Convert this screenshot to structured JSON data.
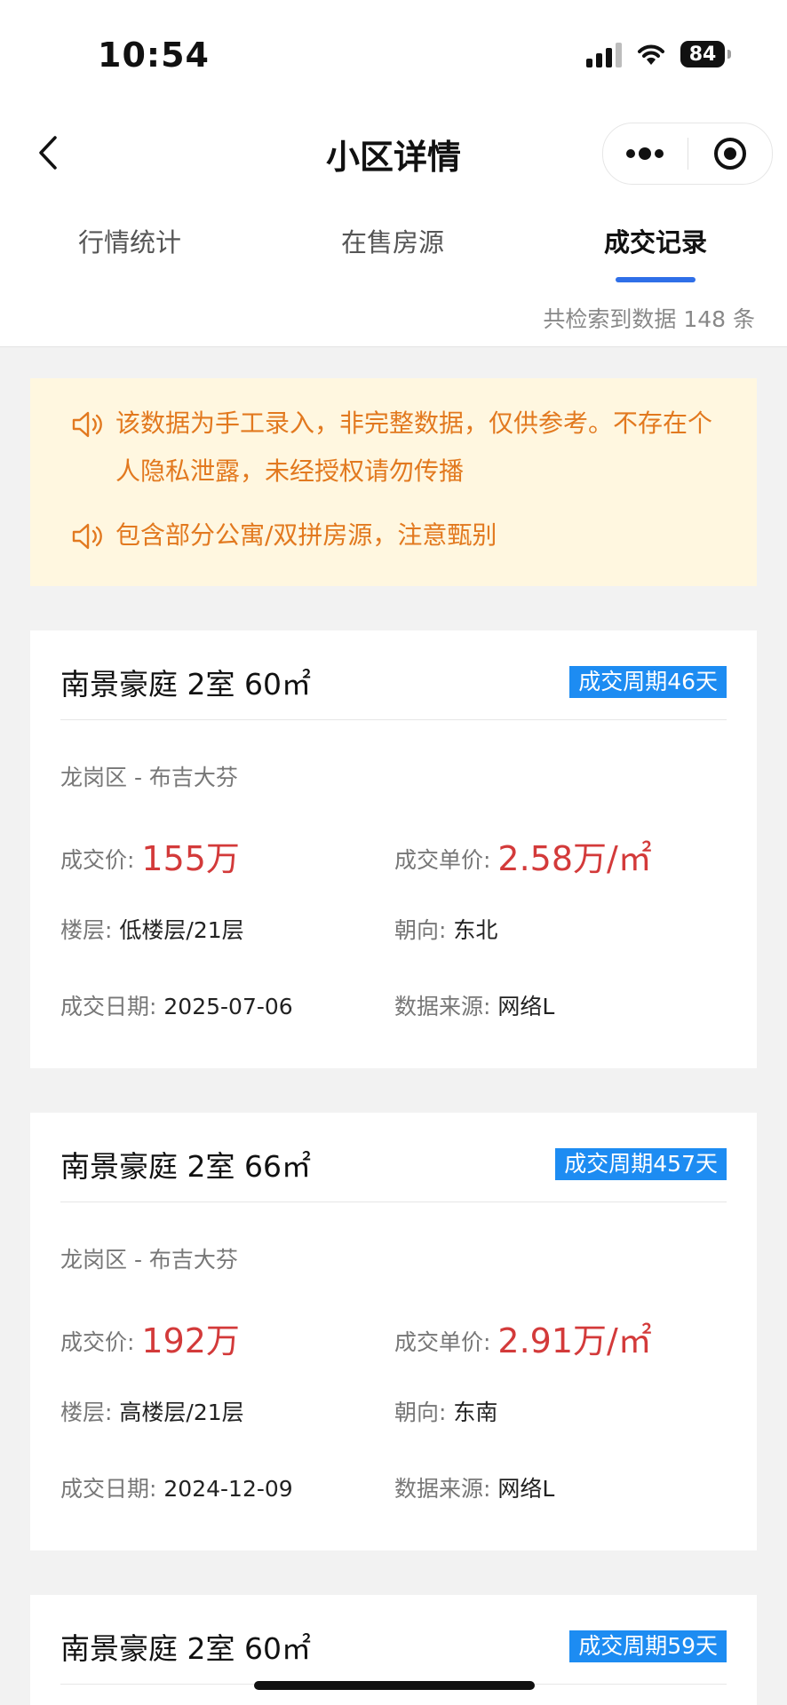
{
  "status_bar": {
    "time": "10:54",
    "battery": "84"
  },
  "header": {
    "title": "小区详情"
  },
  "tabs": [
    {
      "label": "行情统计"
    },
    {
      "label": "在售房源"
    },
    {
      "label": "成交记录"
    }
  ],
  "result_count": "共检索到数据 148 条",
  "notices": [
    "该数据为手工录入，非完整数据，仅供参考。不存在个人隐私泄露，未经授权请勿传播",
    "包含部分公寓/双拼房源，注意甄别"
  ],
  "labels": {
    "deal_price": "成交价:",
    "unit_price": "成交单价:",
    "floor": "楼层:",
    "orientation": "朝向:",
    "deal_date": "成交日期:",
    "source": "数据来源:"
  },
  "records": [
    {
      "title": "南景豪庭 2室 60㎡",
      "cycle": "成交周期46天",
      "district": "龙岗区 - 布吉大芬",
      "deal_price": "155万",
      "unit_price": "2.58万/㎡",
      "floor": "低楼层/21层",
      "orientation": "东北",
      "deal_date": "2025-07-06",
      "source": "网络L"
    },
    {
      "title": "南景豪庭 2室 66㎡",
      "cycle": "成交周期457天",
      "district": "龙岗区 - 布吉大芬",
      "deal_price": "192万",
      "unit_price": "2.91万/㎡",
      "floor": "高楼层/21层",
      "orientation": "东南",
      "deal_date": "2024-12-09",
      "source": "网络L"
    },
    {
      "title": "南景豪庭 2室 60㎡",
      "cycle": "成交周期59天"
    }
  ],
  "colors": {
    "accent": "#2f6fe8",
    "price_red": "#d33a3a",
    "badge_blue": "#1d8cf2",
    "notice_orange": "#e2791f",
    "notice_bg": "#fff7e0"
  }
}
